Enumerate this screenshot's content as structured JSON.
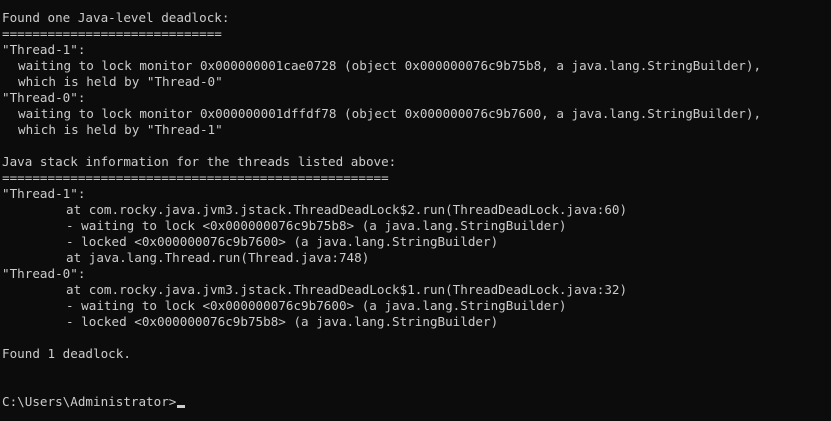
{
  "console": {
    "lines": [
      {
        "text": "Found one Java-level deadlock:",
        "indent": 0
      },
      {
        "text": "=============================",
        "indent": 0
      },
      {
        "text": "\"Thread-1\":",
        "indent": 0
      },
      {
        "text": "waiting to lock monitor 0x000000001cae0728 (object 0x000000076c9b75b8, a java.lang.StringBuilder),",
        "indent": 1
      },
      {
        "text": "which is held by \"Thread-0\"",
        "indent": 1
      },
      {
        "text": "\"Thread-0\":",
        "indent": 0
      },
      {
        "text": "waiting to lock monitor 0x000000001dffdf78 (object 0x000000076c9b7600, a java.lang.StringBuilder),",
        "indent": 1
      },
      {
        "text": "which is held by \"Thread-1\"",
        "indent": 1
      },
      {
        "text": "",
        "indent": 0
      },
      {
        "text": "Java stack information for the threads listed above:",
        "indent": 0
      },
      {
        "text": "===================================================",
        "indent": 0
      },
      {
        "text": "\"Thread-1\":",
        "indent": 0
      },
      {
        "text": "at com.rocky.java.jvm3.jstack.ThreadDeadLock$2.run(ThreadDeadLock.java:60)",
        "indent": 2
      },
      {
        "text": "- waiting to lock <0x000000076c9b75b8> (a java.lang.StringBuilder)",
        "indent": 2
      },
      {
        "text": "- locked <0x000000076c9b7600> (a java.lang.StringBuilder)",
        "indent": 2
      },
      {
        "text": "at java.lang.Thread.run(Thread.java:748)",
        "indent": 2
      },
      {
        "text": "\"Thread-0\":",
        "indent": 0
      },
      {
        "text": "at com.rocky.java.jvm3.jstack.ThreadDeadLock$1.run(ThreadDeadLock.java:32)",
        "indent": 2
      },
      {
        "text": "- waiting to lock <0x000000076c9b7600> (a java.lang.StringBuilder)",
        "indent": 2
      },
      {
        "text": "- locked <0x000000076c9b75b8> (a java.lang.StringBuilder)",
        "indent": 2
      },
      {
        "text": "",
        "indent": 0
      },
      {
        "text": "Found 1 deadlock.",
        "indent": 0
      },
      {
        "text": "",
        "indent": 0
      },
      {
        "text": "",
        "indent": 0
      }
    ],
    "prompt": "C:\\Users\\Administrator>"
  },
  "colors": {
    "background": "#0c0c0c",
    "foreground": "#cccccc"
  }
}
